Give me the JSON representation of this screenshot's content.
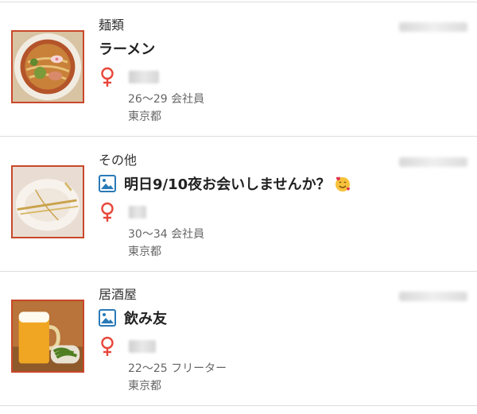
{
  "posts": [
    {
      "category": "麺類",
      "title": "ラーメン",
      "age_job": "26〜29 会社員",
      "location": "東京都",
      "has_image_icon": false,
      "thumb_icon": "ramen-photo"
    },
    {
      "category": "その他",
      "title": "明日9/10夜お会いしませんか？",
      "age_job": "30〜34 会社員",
      "location": "東京都",
      "has_image_icon": true,
      "emoji_icon": "smiling-face-with-hearts-icon",
      "thumb_icon": "plate-cutlery-photo"
    },
    {
      "category": "居酒屋",
      "title": "飲み友",
      "age_job": "22〜25 フリーター",
      "location": "東京都",
      "has_image_icon": true,
      "thumb_icon": "beer-edamame-photo"
    }
  ],
  "colors": {
    "accent": "#c9472b",
    "gender_icon": "#e8463a",
    "image_icon": "#2a7ab8",
    "separator": "#dddddd"
  }
}
